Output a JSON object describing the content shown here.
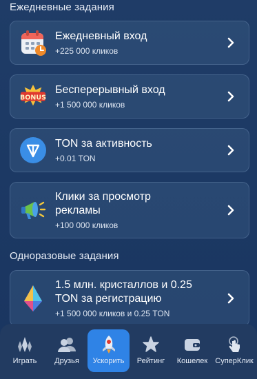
{
  "daily": {
    "title": "Ежедневные задания",
    "items": [
      {
        "title": "Ежедневный вход",
        "sub": "+225 000 кликов",
        "icon": "calendar-icon"
      },
      {
        "title": "Бесперерывный вход",
        "sub": "+1 500 000 кликов",
        "icon": "bonus-icon"
      },
      {
        "title": "TON за активность",
        "sub": "+0.01 TON",
        "icon": "ton-icon"
      },
      {
        "title_line1": "Клики за просмотр",
        "title_line2": "рекламы",
        "sub": "+100 000 кликов",
        "icon": "megaphone-icon"
      }
    ]
  },
  "onetime": {
    "title": "Одноразовые задания",
    "items": [
      {
        "title_line1": "1.5 млн. кристаллов и 0.25",
        "title_line2": "TON за регистрацию",
        "sub": "+1 500 000 кликов и 0.25 TON",
        "icon": "crystal-icon"
      }
    ]
  },
  "nav": {
    "items": [
      {
        "label": "Играть",
        "icon": "crystals-icon"
      },
      {
        "label": "Друзья",
        "icon": "friends-icon"
      },
      {
        "label": "Ускорить",
        "icon": "rocket-icon",
        "active": true
      },
      {
        "label": "Рейтинг",
        "icon": "star-icon"
      },
      {
        "label": "Кошелек",
        "icon": "wallet-icon"
      },
      {
        "label": "СуперКлик",
        "icon": "tap-icon"
      }
    ]
  },
  "colors": {
    "background": "#1d3a65",
    "active_nav": "#2f83e6",
    "ton_blue": "#3a8ee6"
  }
}
